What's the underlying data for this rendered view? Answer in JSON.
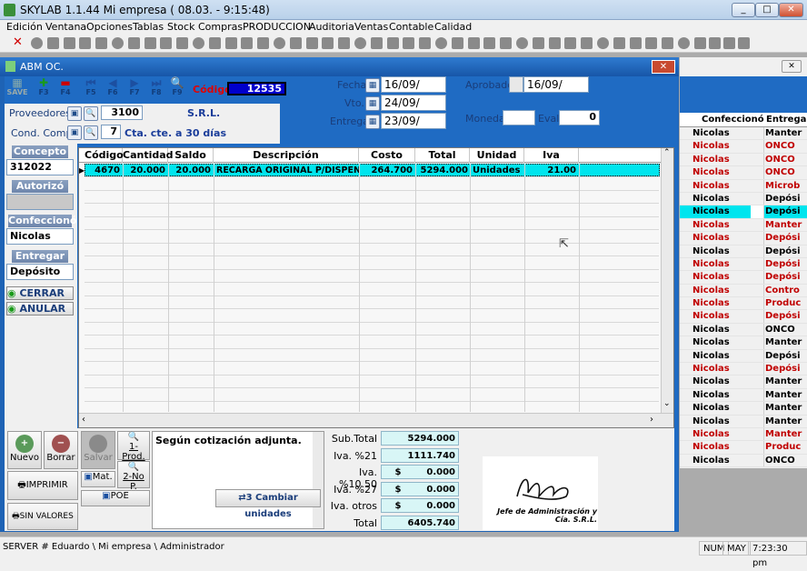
{
  "app": {
    "title": "SKYLAB 1.1.44  Mi empresa  ( 08.03.        -  9:15:48)"
  },
  "menu": [
    "Edición",
    "Ventana",
    "Opciones",
    "Tablas",
    "Stock",
    "Compras",
    "PRODUCCION",
    "Auditoria",
    "Ventas",
    "Contable",
    "Calidad"
  ],
  "child": {
    "title": "ABM OC."
  },
  "nav": {
    "save": "SAVE",
    "f3": "F3",
    "f4": "F4",
    "f5": "F5",
    "f6": "F6",
    "f7": "F7",
    "f8": "F8",
    "f9": "F9"
  },
  "header": {
    "codigo_label": "Código :",
    "codigo_value": "12535",
    "fecha_label": "Fecha",
    "fecha_value": "16/09/",
    "vto_label": "Vto.",
    "vto_value": "24/09/",
    "entrega_label": "Entrega",
    "entrega_value": "23/09/",
    "aprobado_label": "Aprobado",
    "aprobado_value": "16/09/",
    "moneda_label": "Moneda",
    "moneda_value": "",
    "eval_label": "Eval.",
    "eval_value": "0",
    "proveedores_label": "Proveedores",
    "proveedor_code": "3100",
    "proveedor_name": "S.R.L.",
    "cond_label": "Cond. Comp.",
    "cond_code": "7",
    "cond_desc": "Cta. cte. a 30 días"
  },
  "side": {
    "concepto_label": "Concepto",
    "concepto_value": "312022",
    "autorizo_label": "Autorizó",
    "autorizo_value": "",
    "confecciono_label": "Confeccionó",
    "confecciono_value": "Nicolas",
    "entregar_label": "Entregar a.",
    "entregar_value": "Depósito",
    "cerrar": "CERRAR",
    "anular": "ANULAR"
  },
  "grid": {
    "columns": [
      "Código",
      "Cantidad",
      "Saldo",
      "Descripción",
      "Costo",
      "Total",
      "Unidad",
      "Iva"
    ],
    "rows": [
      [
        "4670",
        "20.000",
        "20.000",
        "RECARGA ORIGINAL P/DISPENSER (",
        "264.700",
        "5294.000",
        "Unidades",
        "21.00"
      ]
    ]
  },
  "bottom": {
    "nuevo": "Nuevo",
    "borrar": "Borrar",
    "salvar": "Salvar",
    "prod": "1-Prod.",
    "nop": "2-No P.",
    "mat": "Mat.",
    "imprimir": "IMPRIMIR",
    "sinvalores": "SIN VALORES",
    "poe": "POE",
    "cambiar": "3 Cambiar unidades",
    "nota": "Según cotización adjunta.",
    "signature": "Jefe de Administración y Cía. S.R.L."
  },
  "totals": [
    {
      "label": "Sub.Total",
      "value": "5294.000"
    },
    {
      "label": "Iva. %21",
      "value": "1111.740"
    },
    {
      "label": "Iva. %10.50",
      "value": "$        0.000"
    },
    {
      "label": "Iva. %27",
      "value": "$        0.000"
    },
    {
      "label": "Iva. otros",
      "value": "$        0.000"
    },
    {
      "label": "Total",
      "value": "6405.740"
    }
  ],
  "right": {
    "col1": "Confeccionó",
    "col2": "Entregar",
    "rows": [
      [
        "Nicolas",
        "Manter"
      ],
      [
        "Nicolas",
        "ONCO"
      ],
      [
        "Nicolas",
        "ONCO"
      ],
      [
        "Nicolas",
        "ONCO"
      ],
      [
        "Nicolas",
        "Microb"
      ],
      [
        "Nicolas",
        "Depósi"
      ],
      [
        "Nicolas",
        "Depósi"
      ],
      [
        "Nicolas",
        "Manter"
      ],
      [
        "Nicolas",
        "Depósi"
      ],
      [
        "Nicolas",
        "Depósi"
      ],
      [
        "Nicolas",
        "Depósi"
      ],
      [
        "Nicolas",
        "Depósi"
      ],
      [
        "Nicolas",
        "Contro"
      ],
      [
        "Nicolas",
        "Produc"
      ],
      [
        "Nicolas",
        "Depósi"
      ],
      [
        "Nicolas",
        "ONCO"
      ],
      [
        "Nicolas",
        "Manter"
      ],
      [
        "Nicolas",
        "Depósi"
      ],
      [
        "Nicolas",
        "Depósi"
      ],
      [
        "Nicolas",
        "Manter"
      ],
      [
        "Nicolas",
        "Manter"
      ],
      [
        "Nicolas",
        "Manter"
      ],
      [
        "Nicolas",
        "Manter"
      ],
      [
        "Nicolas",
        "Manter"
      ],
      [
        "Nicolas",
        "Produc"
      ],
      [
        "Nicolas",
        "ONCO"
      ]
    ],
    "row_colors": [
      "b",
      "r",
      "r",
      "r",
      "r",
      "b",
      "sel",
      "r",
      "r",
      "b",
      "r",
      "r",
      "r",
      "r",
      "r",
      "b",
      "b",
      "b",
      "r",
      "b",
      "b",
      "b",
      "b",
      "r",
      "r",
      "b"
    ]
  },
  "status": {
    "path": "SERVER # Eduardo \\ Mi empresa \\ Administrador",
    "num": "NUM",
    "may": "MAY",
    "time": "7:23:30 pm"
  },
  "colors": {
    "red": "#c00000",
    "selected": "#00e5ee",
    "header_blue": "#1f6bc3"
  }
}
